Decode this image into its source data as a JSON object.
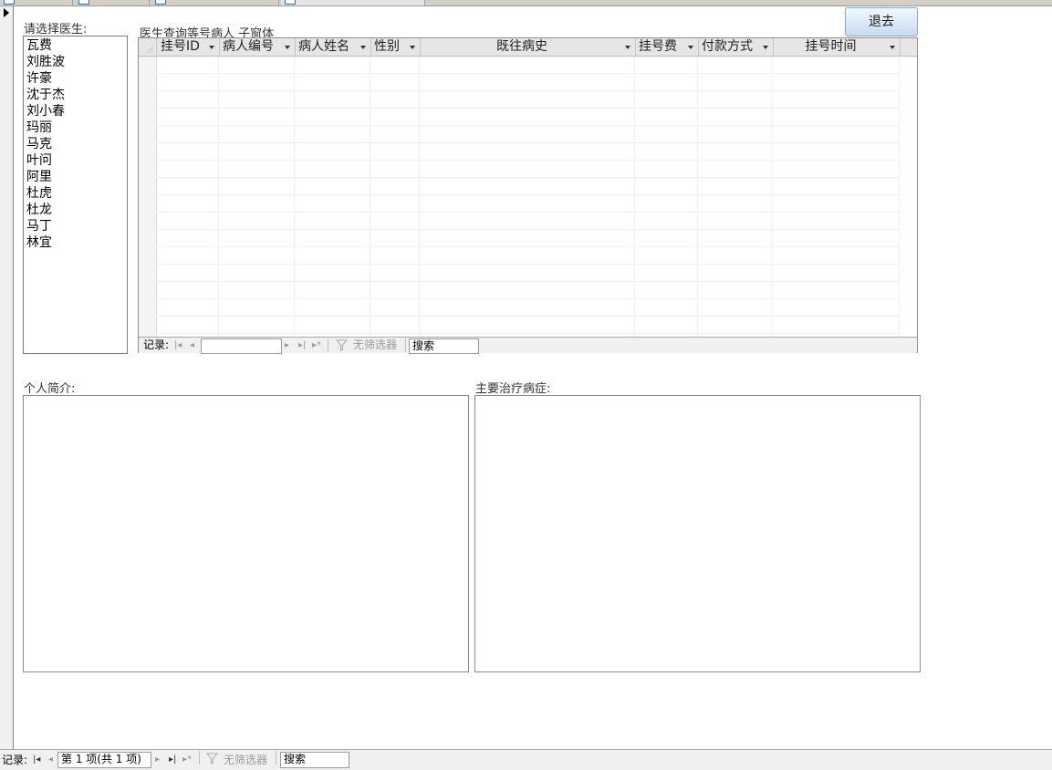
{
  "form": {
    "doctor_list_label": "请选择医生:",
    "subform_label": "医生查询等号病人 子窗体",
    "intro_label": "个人简介:",
    "treatment_label": "主要治疗病症:",
    "exit_button": "退去"
  },
  "doctors": [
    "瓦费",
    "刘胜波",
    "许豪",
    "沈于杰",
    "刘小春",
    "玛丽",
    "马克",
    "叶问",
    "阿里",
    "杜虎",
    "杜龙",
    "马丁",
    "林宜"
  ],
  "datasheet": {
    "columns": [
      "挂号ID",
      "病人编号",
      "病人姓名",
      "性别",
      "既往病史",
      "挂号费",
      "付款方式",
      "挂号时间"
    ]
  },
  "subform_nav": {
    "record_label": "记录:",
    "current_record": "",
    "filter_label": "无筛选器",
    "search_text": "搜索"
  },
  "main_nav": {
    "record_label": "记录:",
    "current_record": "第 1 项(共 1 项)",
    "filter_label": "无筛选器",
    "search_text": "搜索"
  },
  "icons": {
    "first": "first-record-icon",
    "previous": "previous-record-icon",
    "next": "next-record-icon",
    "last": "last-record-icon",
    "new": "new-record-icon",
    "filter": "filter-icon"
  }
}
